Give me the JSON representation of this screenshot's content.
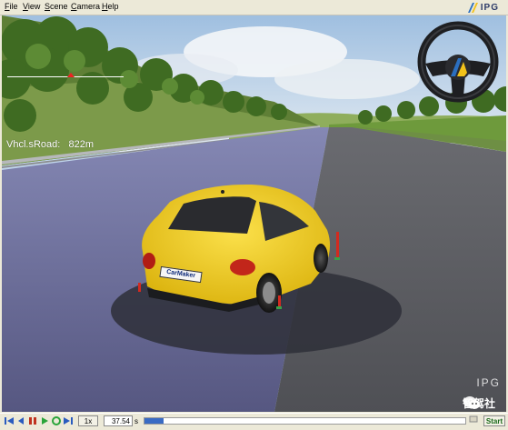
{
  "menu": {
    "items": [
      {
        "label": "File",
        "hot": "F",
        "rest": "ile"
      },
      {
        "label": "View",
        "hot": "V",
        "rest": "iew"
      },
      {
        "label": "Scene",
        "hot": "S",
        "rest": "cene"
      },
      {
        "label": "Camera",
        "hot": "C",
        "rest": "amera"
      },
      {
        "label": "Help",
        "hot": "H",
        "rest": "elp"
      }
    ],
    "brand": "IPG"
  },
  "viewport": {
    "road_readout": "Vhcl.sRoad:   822m",
    "plate_text": "CarMaker",
    "watermark_brand": "IPG",
    "watermark_text": "智驾社"
  },
  "toolbar": {
    "speed": "1x",
    "time_value": "37.54",
    "time_unit": "s",
    "start_label": "Start",
    "progress_fraction": 0.06
  },
  "colors": {
    "car_yellow": "#f2cc16",
    "sky": "#bcd4ec",
    "road_left": "#6d6f9c",
    "road_right": "#5f6066",
    "grass": "#7a9a4a",
    "progress": "#3a6bc4"
  },
  "icons": [
    "rewind-icon",
    "step-back-icon",
    "pause-icon",
    "play-icon",
    "record-icon",
    "fast-forward-icon",
    "steering-wheel-icon"
  ]
}
